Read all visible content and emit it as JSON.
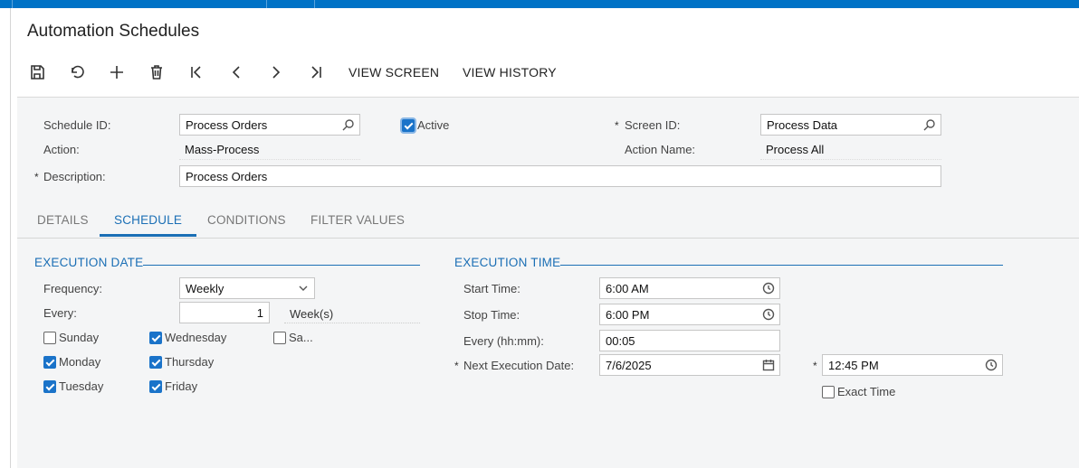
{
  "page": {
    "title": "Automation Schedules"
  },
  "toolbar": {
    "save": "save-icon",
    "undo": "undo-icon",
    "add": "add-icon",
    "delete": "trash-icon",
    "first": "first-icon",
    "prev": "prev-icon",
    "next": "next-icon",
    "last": "last-icon",
    "view_screen": "VIEW SCREEN",
    "view_history": "VIEW HISTORY"
  },
  "header": {
    "schedule_id_label": "Schedule ID:",
    "schedule_id_value": "Process Orders",
    "active_label": "Active",
    "active_checked": true,
    "screen_id_label": "Screen ID:",
    "screen_id_value": "Process Data",
    "action_label": "Action:",
    "action_value": "Mass-Process",
    "action_name_label": "Action Name:",
    "action_name_value": "Process All",
    "description_label": "Description:",
    "description_value": "Process Orders",
    "required_mark": "*"
  },
  "tabs": [
    {
      "label": "DETAILS",
      "selected": false
    },
    {
      "label": "SCHEDULE",
      "selected": true
    },
    {
      "label": "CONDITIONS",
      "selected": false
    },
    {
      "label": "FILTER VALUES",
      "selected": false
    }
  ],
  "execution_date": {
    "title": "EXECUTION DATE",
    "frequency_label": "Frequency:",
    "frequency_value": "Weekly",
    "every_label": "Every:",
    "every_value": "1",
    "every_unit": "Week(s)",
    "days": [
      {
        "label": "Sunday",
        "checked": false
      },
      {
        "label": "Monday",
        "checked": true
      },
      {
        "label": "Tuesday",
        "checked": true
      },
      {
        "label": "Wednesday",
        "checked": true
      },
      {
        "label": "Thursday",
        "checked": true
      },
      {
        "label": "Friday",
        "checked": true
      },
      {
        "label": "Sa...",
        "checked": false
      }
    ]
  },
  "execution_time": {
    "title": "EXECUTION TIME",
    "start_label": "Start Time:",
    "start_value": "6:00 AM",
    "stop_label": "Stop Time:",
    "stop_value": "6:00 PM",
    "every_label": "Every (hh:mm):",
    "every_value": "00:05",
    "next_label": "Next Execution Date:",
    "next_date": "7/6/2025",
    "next_time": "12:45 PM",
    "exact_time_label": "Exact Time",
    "exact_time_checked": false
  },
  "colors": {
    "accent": "#1b6fb5",
    "topbar": "#0072c6",
    "checkbox": "#1a73c9"
  }
}
